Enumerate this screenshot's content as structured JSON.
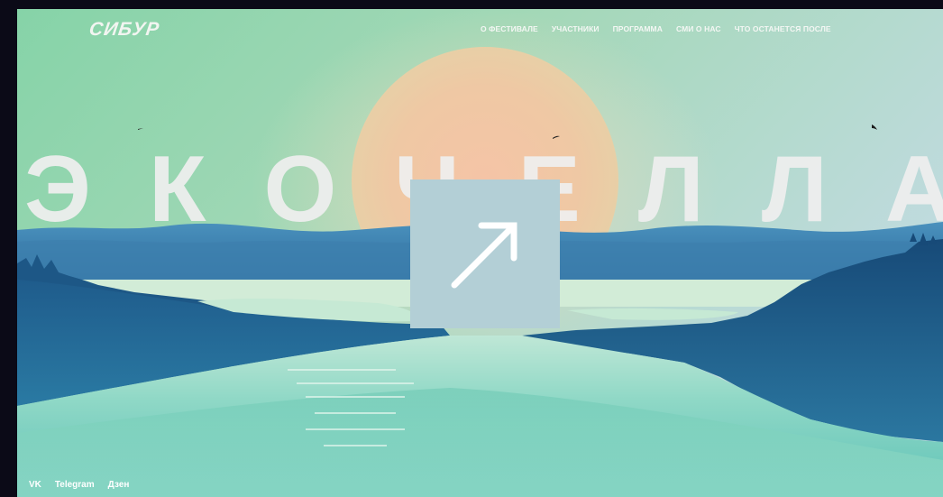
{
  "brand": {
    "logo_text": "СИБУР"
  },
  "nav": {
    "items": [
      {
        "label": "О ФЕСТИВАЛЕ"
      },
      {
        "label": "УЧАСТНИКИ"
      },
      {
        "label": "ПРОГРАММА"
      },
      {
        "label": "СМИ О НАС"
      },
      {
        "label": "ЧТО ОСТАНЕТСЯ ПОСЛЕ"
      }
    ]
  },
  "hero": {
    "letters": [
      "Э",
      "К",
      "О",
      "Ч",
      "Е",
      "Л",
      "Л",
      "А"
    ]
  },
  "play_card": {
    "icon": "arrow-up-right-icon"
  },
  "socials": {
    "items": [
      {
        "label": "VK"
      },
      {
        "label": "Telegram"
      },
      {
        "label": "Дзен"
      }
    ]
  },
  "colors": {
    "sky_top": "#8fd4ad",
    "sky_right": "#b9d9dd",
    "sun": "#f2c6a6",
    "mountains": "#3f86b4",
    "water": "#8ed6c6",
    "shore_dark": "#174e7b",
    "page_bg": "#0b0a17",
    "card": "#b3cfd6"
  }
}
